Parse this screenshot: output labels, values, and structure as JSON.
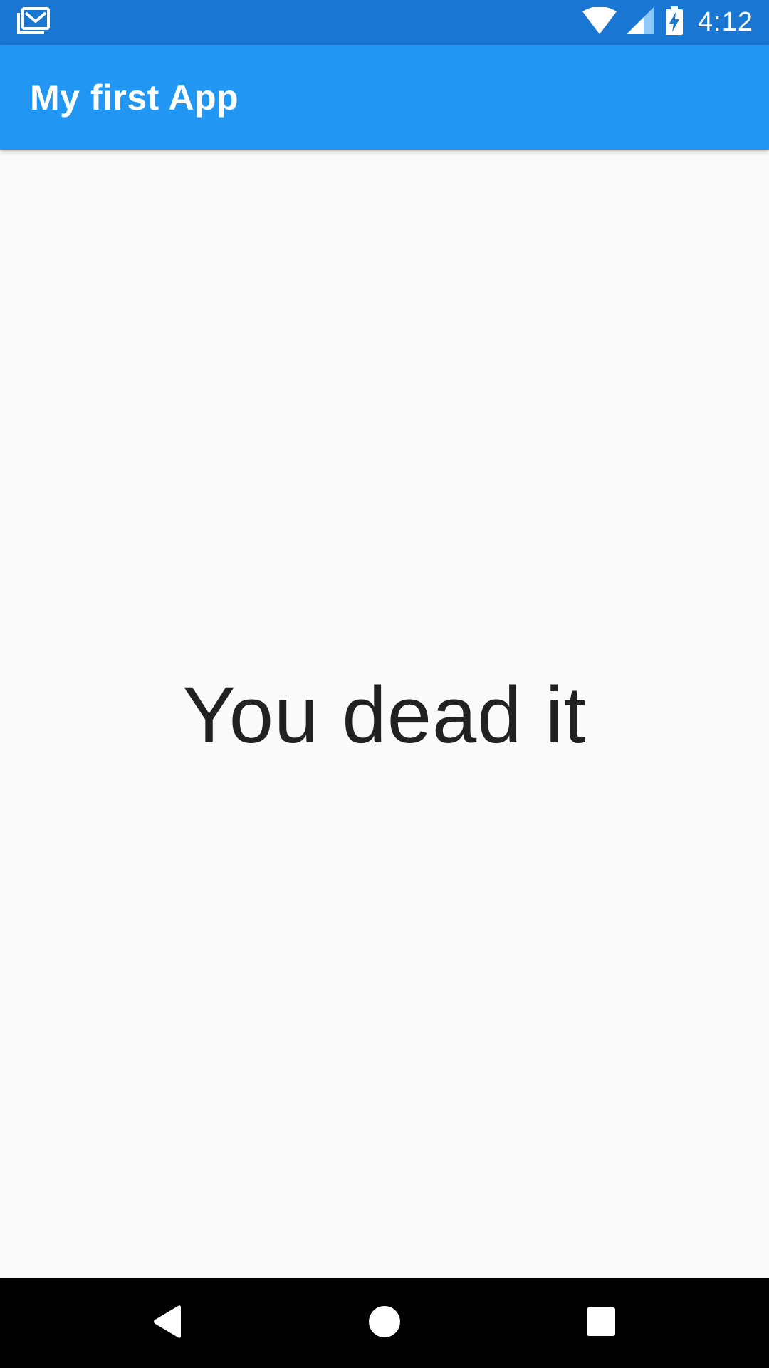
{
  "status_bar": {
    "time": "4:12",
    "icons": [
      "gmail-icon",
      "wifi-icon",
      "cellular-signal-icon",
      "battery-charging-icon"
    ],
    "background": "#1976d2"
  },
  "app_bar": {
    "title": "My first App",
    "background": "#2196f3"
  },
  "main": {
    "message": "You dead it",
    "text_color": "#212121",
    "background": "#fafafa"
  },
  "nav_bar": {
    "buttons": [
      "back-icon",
      "home-icon",
      "recents-icon"
    ],
    "background": "#000000"
  }
}
